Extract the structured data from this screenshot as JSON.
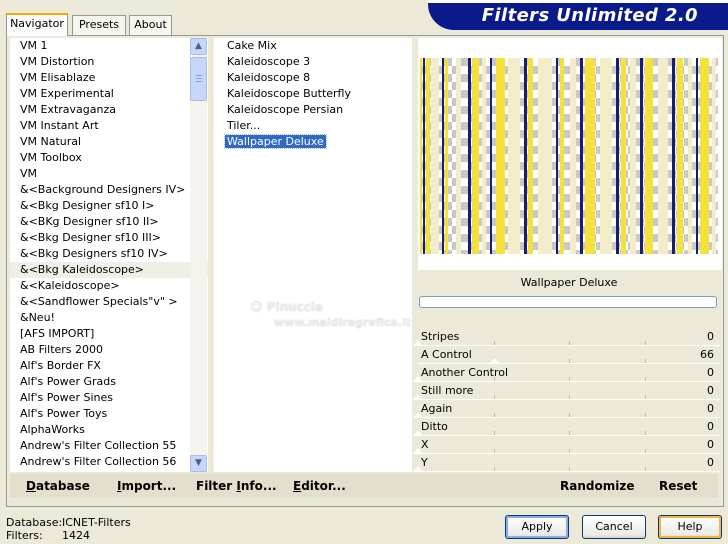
{
  "banner": {
    "title": "Filters Unlimited 2.0"
  },
  "tabs": [
    {
      "label": "Navigator",
      "active": true
    },
    {
      "label": "Presets",
      "active": false
    },
    {
      "label": "About",
      "active": false
    }
  ],
  "categories": [
    "VM 1",
    "VM Distortion",
    "VM Elisablaze",
    "VM Experimental",
    "VM Extravaganza",
    "VM Instant Art",
    "VM Natural",
    "VM Toolbox",
    "VM",
    "&<Background Designers IV>",
    "&<Bkg Designer sf10 I>",
    "&<BKg Designer sf10 II>",
    "&<Bkg Designer sf10 III>",
    "&<Bkg Designers sf10 IV>",
    "&<Bkg Kaleidoscope>",
    "&<Kaleidoscope>",
    "&<Sandflower Specials\"v\" >",
    "&Neu!",
    "[AFS IMPORT]",
    "AB Filters 2000",
    "Alf's Border FX",
    "Alf's Power Grads",
    "Alf's Power Sines",
    "Alf's Power Toys",
    "AlphaWorks",
    "Andrew's Filter Collection 55",
    "Andrew's Filter Collection 56"
  ],
  "selected_category": "&<Bkg Kaleidoscope>",
  "filters": [
    "Cake Mix",
    "Kaleidoscope 3",
    "Kaleidoscope 8",
    "Kaleidoscope Butterfly",
    "Kaleidoscope Persian",
    "Tiler...",
    "Wallpaper Deluxe"
  ],
  "selected_filter": "Wallpaper Deluxe",
  "preview": {
    "filter_name": "Wallpaper Deluxe"
  },
  "controls": [
    {
      "label": "Stripes",
      "value": "0"
    },
    {
      "label": "A Control",
      "value": "66"
    },
    {
      "label": "Another Control",
      "value": "0"
    },
    {
      "label": "Still more",
      "value": "0"
    },
    {
      "label": "Again",
      "value": "0"
    },
    {
      "label": "Ditto",
      "value": "0"
    },
    {
      "label": "X",
      "value": "0"
    },
    {
      "label": "Y",
      "value": "0"
    }
  ],
  "bar": {
    "database": {
      "u": "D",
      "rest": "atabase"
    },
    "import": {
      "u": "I",
      "rest": "mport..."
    },
    "filter_info": {
      "pre": "Filter ",
      "u": "I",
      "rest": "nfo..."
    },
    "editor": {
      "u": "E",
      "rest": "ditor..."
    },
    "randomize": "Randomize",
    "reset": "Reset"
  },
  "info": {
    "database_label": "Database:",
    "database_value": "ICNET-Filters",
    "filters_label": "Filters:",
    "filters_value": "1424"
  },
  "buttons": {
    "apply": "Apply",
    "cancel": "Cancel",
    "help": "Help"
  },
  "watermark": {
    "name": "Pinuccia",
    "url": "www.maidiregrafica.it"
  },
  "colors": {
    "selection": "#316ac5",
    "banner": "#0a1a8a",
    "stripe_yellow": "#f4e23a",
    "stripe_navy": "#1a1d6a",
    "stripe_cream": "#f3ecc8"
  },
  "icons": [
    "scroll-up-icon",
    "scroll-down-icon",
    "logo-watermark-icon"
  ]
}
